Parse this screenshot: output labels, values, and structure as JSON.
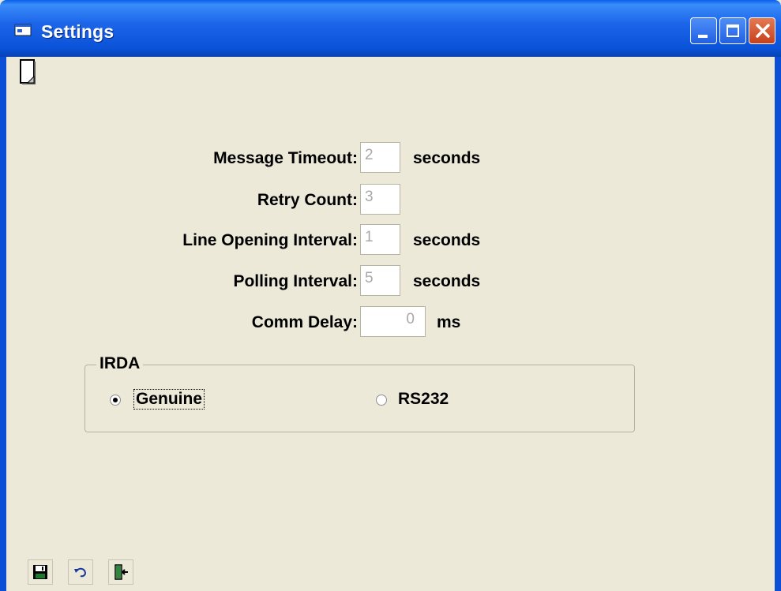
{
  "window": {
    "title": "Settings",
    "minimize_icon": "minimize-icon",
    "maximize_icon": "maximize-icon",
    "close_icon": "close-icon"
  },
  "form": {
    "message_timeout": {
      "label": "Message Timeout:",
      "value": "2",
      "unit": "seconds"
    },
    "retry_count": {
      "label": "Retry Count:",
      "value": "3"
    },
    "line_opening_interval": {
      "label": "Line Opening Interval:",
      "value": "1",
      "unit": "seconds"
    },
    "polling_interval": {
      "label": "Polling Interval:",
      "value": "5",
      "unit": "seconds"
    },
    "comm_delay": {
      "label": "Comm Delay:",
      "value": "0",
      "unit": "ms"
    }
  },
  "irda": {
    "title": "IRDA",
    "options": [
      {
        "label": "Genuine",
        "selected": true
      },
      {
        "label": "RS232",
        "selected": false
      }
    ]
  },
  "toolbar": {
    "icons": [
      "save-icon",
      "undo-icon",
      "exit-icon"
    ]
  },
  "colors": {
    "titlebar": "#0a52d8",
    "face": "#ece9d8",
    "disabled_text": "#a9a9a9"
  }
}
